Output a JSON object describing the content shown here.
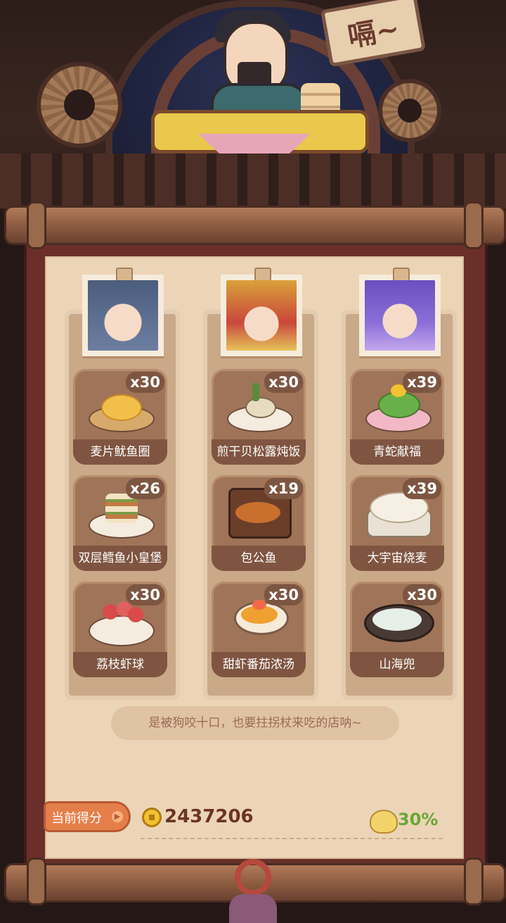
{
  "sign": {
    "text": "嗝~"
  },
  "columns": [
    {
      "portrait_icon": "blue-haired-girl-portrait-icon",
      "dishes": [
        {
          "name": "麦片鱿鱼圈",
          "count": "x30",
          "icon": "cereal-squid-rings-icon"
        },
        {
          "name": "双层鳕鱼小皇堡",
          "count": "x26",
          "icon": "cod-burger-icon"
        },
        {
          "name": "荔枝虾球",
          "count": "x30",
          "icon": "lychee-shrimp-balls-icon"
        }
      ]
    },
    {
      "portrait_icon": "crowned-character-portrait-icon",
      "dishes": [
        {
          "name": "煎干贝松露炖饭",
          "count": "x30",
          "icon": "scallop-risotto-icon"
        },
        {
          "name": "包公鱼",
          "count": "x19",
          "icon": "baogong-fish-icon"
        },
        {
          "name": "甜虾番茄浓汤",
          "count": "x30",
          "icon": "shrimp-tomato-soup-icon"
        }
      ]
    },
    {
      "portrait_icon": "purple-haired-character-portrait-icon",
      "dishes": [
        {
          "name": "青蛇献福",
          "count": "x39",
          "icon": "green-snake-dish-icon"
        },
        {
          "name": "大宇宙烧麦",
          "count": "x39",
          "icon": "giant-shaomai-icon"
        },
        {
          "name": "山海兜",
          "count": "x30",
          "icon": "shanhai-dou-icon"
        }
      ]
    }
  ],
  "quote": "是被狗咬十口，也要拄拐杖来吃的店呐~",
  "score": {
    "label": "当前得分",
    "value": "2437206",
    "bonus": "30%"
  },
  "colors": {
    "scroll_frame": "#6b2f2a",
    "paper": "#ecd5b6",
    "card": "#a07458",
    "score_tag": "#e57f4a",
    "bonus": "#6ba53a"
  }
}
